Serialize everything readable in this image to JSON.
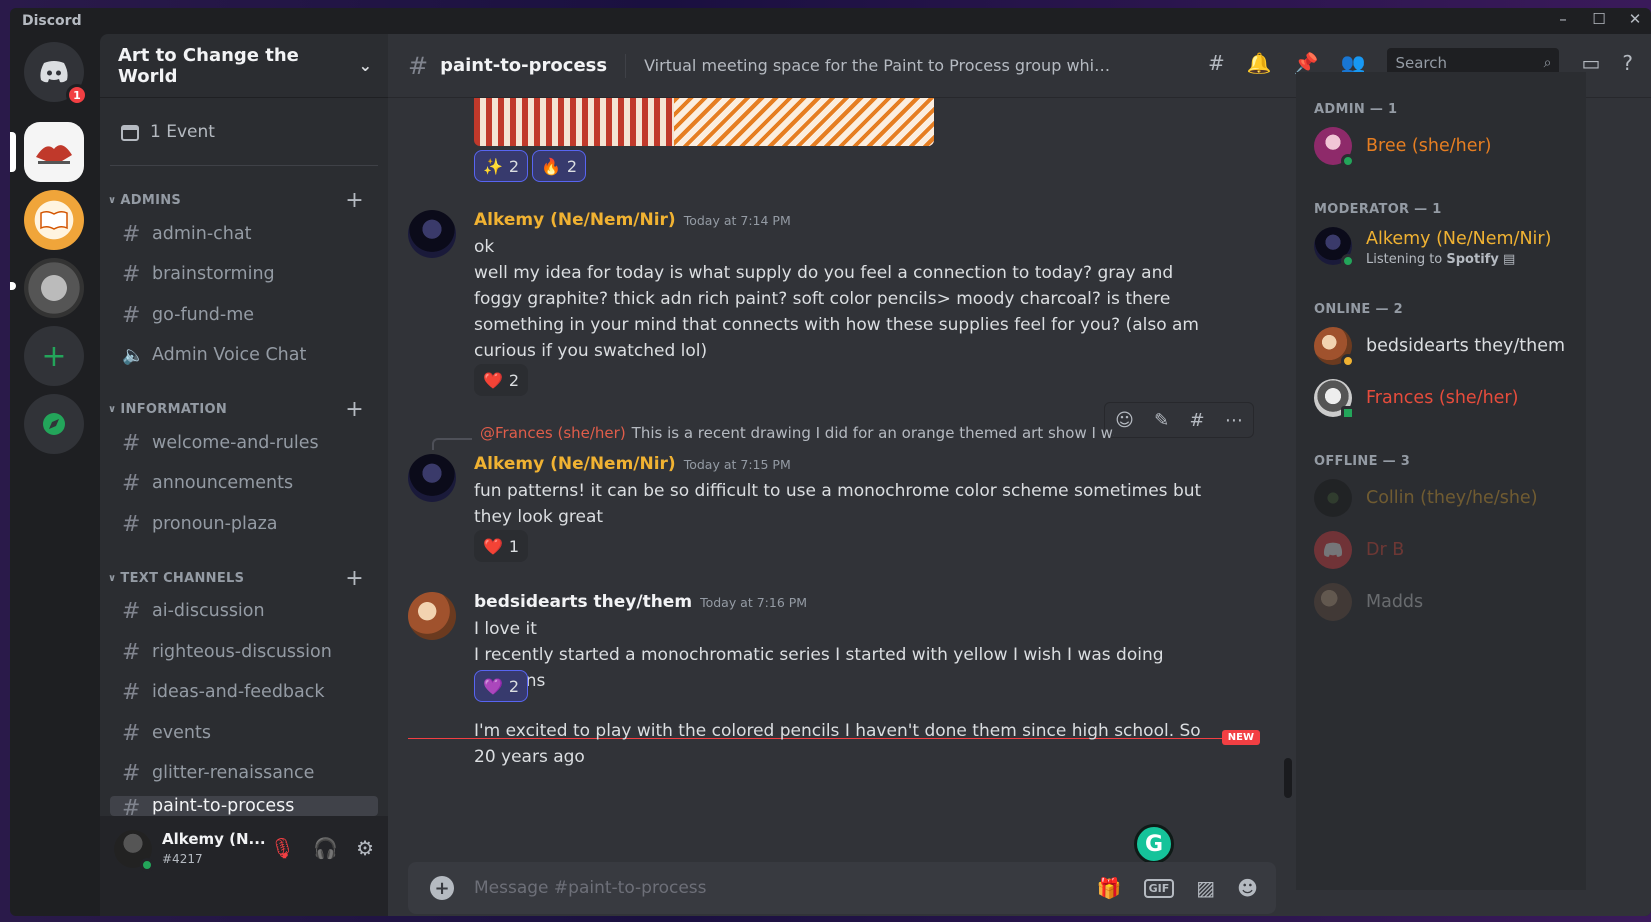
{
  "window": {
    "title": "Discord"
  },
  "rail": {
    "home_badge": "1"
  },
  "sidebar": {
    "guild_name": "Art to Change the World",
    "event_label": "1 Event",
    "categories": [
      {
        "name": "ADMINS",
        "channels": [
          "admin-chat",
          "brainstorming",
          "go-fund-me",
          "Admin Voice Chat"
        ]
      },
      {
        "name": "INFORMATION",
        "channels": [
          "welcome-and-rules",
          "announcements",
          "pronoun-plaza"
        ]
      },
      {
        "name": "TEXT CHANNELS",
        "channels": [
          "ai-discussion",
          "righteous-discussion",
          "ideas-and-feedback",
          "events",
          "glitter-renaissance",
          "paint-to-process"
        ]
      }
    ]
  },
  "user_panel": {
    "name": "Alkemy (N...",
    "tag": "#4217"
  },
  "channel": {
    "name": "paint-to-process",
    "topic": "Virtual meeting space for the Paint to Process group which mee...",
    "search_placeholder": "Search"
  },
  "messages": {
    "top_reactions": [
      {
        "emoji": "✨",
        "count": "2"
      },
      {
        "emoji": "🔥",
        "count": "2"
      }
    ],
    "m1": {
      "author": "Alkemy (Ne/Nem/Nir)",
      "time": "Today at 7:14 PM",
      "line1": "ok",
      "line2": "well my idea for today is what supply do you feel a connection to today? gray and foggy graphite? thick adn rich paint? soft color pencils> moody charcoal? is there something in your mind that connects with how these supplies feel for you? (also am curious if you swatched lol)",
      "reaction": {
        "emoji": "❤️",
        "count": "2"
      }
    },
    "m2": {
      "reply_name": "@Frances (she/her)",
      "reply_text": "This is a recent drawing I did for an orange themed art show I was part of",
      "author": "Alkemy (Ne/Nem/Nir)",
      "time": "Today at 7:15 PM",
      "text": "fun patterns! it can be so difficult to use a monochrome color scheme sometimes but they look great",
      "reaction": {
        "emoji": "❤️",
        "count": "1"
      }
    },
    "m3": {
      "author": "bedsidearts they/them",
      "time": "Today at 7:16 PM",
      "line1": "I love it",
      "line2": "I recently started a monochromatic series I started with yellow I wish I was doing patterns",
      "reaction": {
        "emoji": "💜",
        "count": "2"
      }
    },
    "new_label": "NEW",
    "m4": {
      "text": "I'm excited to play with the colored pencils I haven't done them since high school. So 20 years ago"
    }
  },
  "composer": {
    "placeholder": "Message #paint-to-process",
    "gif_label": "GIF"
  },
  "members": {
    "groups": [
      {
        "title": "ADMIN — 1",
        "members": [
          {
            "name": "Bree (she/her)",
            "color": "#e67e22"
          }
        ]
      },
      {
        "title": "MODERATOR — 1",
        "members": [
          {
            "name": "Alkemy (Ne/Nem/Nir)",
            "color": "#f0b232",
            "activity_prefix": "Listening to ",
            "activity_bold": "Spotify"
          }
        ]
      },
      {
        "title": "ONLINE — 2",
        "members": [
          {
            "name": "bedsidearts they/them",
            "color": "#dbdee1"
          },
          {
            "name": "Frances (she/her)",
            "color": "#e74c3c"
          }
        ]
      },
      {
        "title": "OFFLINE — 3",
        "members": [
          {
            "name": "Collin (they/he/she)",
            "color": "#f0b232"
          },
          {
            "name": "Dr B",
            "color": "#e74c3c"
          },
          {
            "name": "Madds",
            "color": "#dbdee1"
          }
        ]
      }
    ]
  },
  "colors": {
    "accent": "#5865f2",
    "online": "#23a55a",
    "danger": "#f23f43"
  }
}
